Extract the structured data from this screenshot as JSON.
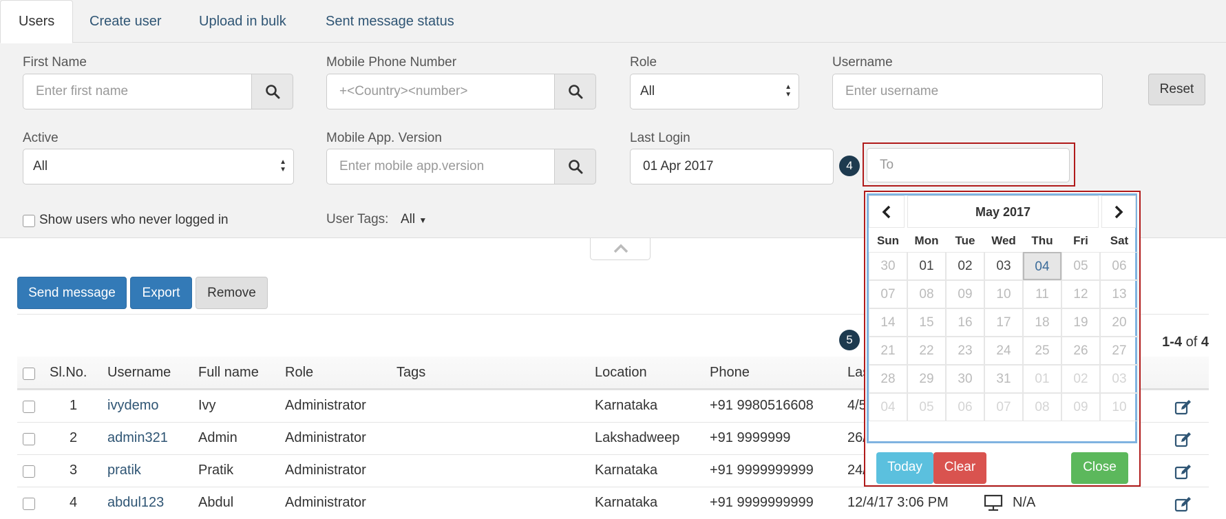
{
  "tabs": [
    {
      "label": "Users"
    },
    {
      "label": "Create user"
    },
    {
      "label": "Upload in bulk"
    },
    {
      "label": "Sent message status"
    }
  ],
  "filters": {
    "first_name": {
      "label": "First Name",
      "placeholder": "Enter first name"
    },
    "mobile": {
      "label": "Mobile Phone Number",
      "placeholder": "+<Country><number>"
    },
    "role": {
      "label": "Role",
      "value": "All"
    },
    "username": {
      "label": "Username",
      "placeholder": "Enter username"
    },
    "reset_label": "Reset",
    "active": {
      "label": "Active",
      "value": "All"
    },
    "app_version": {
      "label": "Mobile App. Version",
      "placeholder": "Enter mobile app.version"
    },
    "last_login": {
      "label": "Last Login",
      "from_value": "01 Apr 2017",
      "to_placeholder": "To"
    },
    "never_logged_label": "Show users who never logged in",
    "user_tags_label": "User Tags:",
    "user_tags_value": "All"
  },
  "badges": {
    "to_field": "4",
    "calendar": "5"
  },
  "actions": {
    "send": "Send message",
    "export": "Export",
    "remove": "Remove"
  },
  "pagination": {
    "range": "1-4",
    "of_text": "of",
    "total": "4"
  },
  "table": {
    "headers": [
      "Sl.No.",
      "Username",
      "Full name",
      "Role",
      "Tags",
      "Location",
      "Phone",
      "Las"
    ],
    "rows": [
      {
        "n": "1",
        "username": "ivydemo",
        "name": "Ivy",
        "role": "Administrator",
        "location": "Karnataka",
        "phone": "+91 9980516608",
        "last": "4/5"
      },
      {
        "n": "2",
        "username": "admin321",
        "name": "Admin",
        "role": "Administrator",
        "location": "Lakshadweep",
        "phone": "+91 9999999",
        "last": "26/"
      },
      {
        "n": "3",
        "username": "pratik",
        "name": "Pratik",
        "role": "Administrator",
        "location": "Karnataka",
        "phone": "+91 9999999999",
        "last": "24/"
      },
      {
        "n": "4",
        "username": "abdul123",
        "name": "Abdul",
        "role": "Administrator",
        "location": "Karnataka",
        "phone": "+91 9999999999",
        "last": "12/4/17 3:06 PM",
        "extra": "N/A"
      }
    ]
  },
  "calendar": {
    "title": "May 2017",
    "weekdays": [
      "Sun",
      "Mon",
      "Tue",
      "Wed",
      "Thu",
      "Fri",
      "Sat"
    ],
    "weeks": [
      [
        [
          "30",
          "muted"
        ],
        [
          "01",
          ""
        ],
        [
          "02",
          ""
        ],
        [
          "03",
          ""
        ],
        [
          "04",
          "sel"
        ],
        [
          "05",
          "muted"
        ],
        [
          "06",
          "muted"
        ]
      ],
      [
        [
          "07",
          "muted"
        ],
        [
          "08",
          "muted"
        ],
        [
          "09",
          "muted"
        ],
        [
          "10",
          "muted"
        ],
        [
          "11",
          "muted"
        ],
        [
          "12",
          "muted"
        ],
        [
          "13",
          "muted"
        ]
      ],
      [
        [
          "14",
          "muted"
        ],
        [
          "15",
          "muted"
        ],
        [
          "16",
          "muted"
        ],
        [
          "17",
          "muted"
        ],
        [
          "18",
          "muted"
        ],
        [
          "19",
          "muted"
        ],
        [
          "20",
          "muted"
        ]
      ],
      [
        [
          "21",
          "muted"
        ],
        [
          "22",
          "muted"
        ],
        [
          "23",
          "muted"
        ],
        [
          "24",
          "muted"
        ],
        [
          "25",
          "muted"
        ],
        [
          "26",
          "muted"
        ],
        [
          "27",
          "muted"
        ]
      ],
      [
        [
          "28",
          "muted"
        ],
        [
          "29",
          "muted"
        ],
        [
          "30",
          "muted"
        ],
        [
          "31",
          "muted"
        ],
        [
          "01",
          "muted2"
        ],
        [
          "02",
          "muted2"
        ],
        [
          "03",
          "muted2"
        ]
      ],
      [
        [
          "04",
          "muted2"
        ],
        [
          "05",
          "muted2"
        ],
        [
          "06",
          "muted2"
        ],
        [
          "07",
          "muted2"
        ],
        [
          "08",
          "muted2"
        ],
        [
          "09",
          "muted2"
        ],
        [
          "10",
          "muted2"
        ]
      ]
    ],
    "today": "Today",
    "clear": "Clear",
    "close": "Close"
  },
  "colors": {
    "primary": "#337ab7",
    "today": "#5bc0de",
    "clear": "#d9534f",
    "close": "#5cb85c",
    "highlight": "#b01a1a"
  }
}
